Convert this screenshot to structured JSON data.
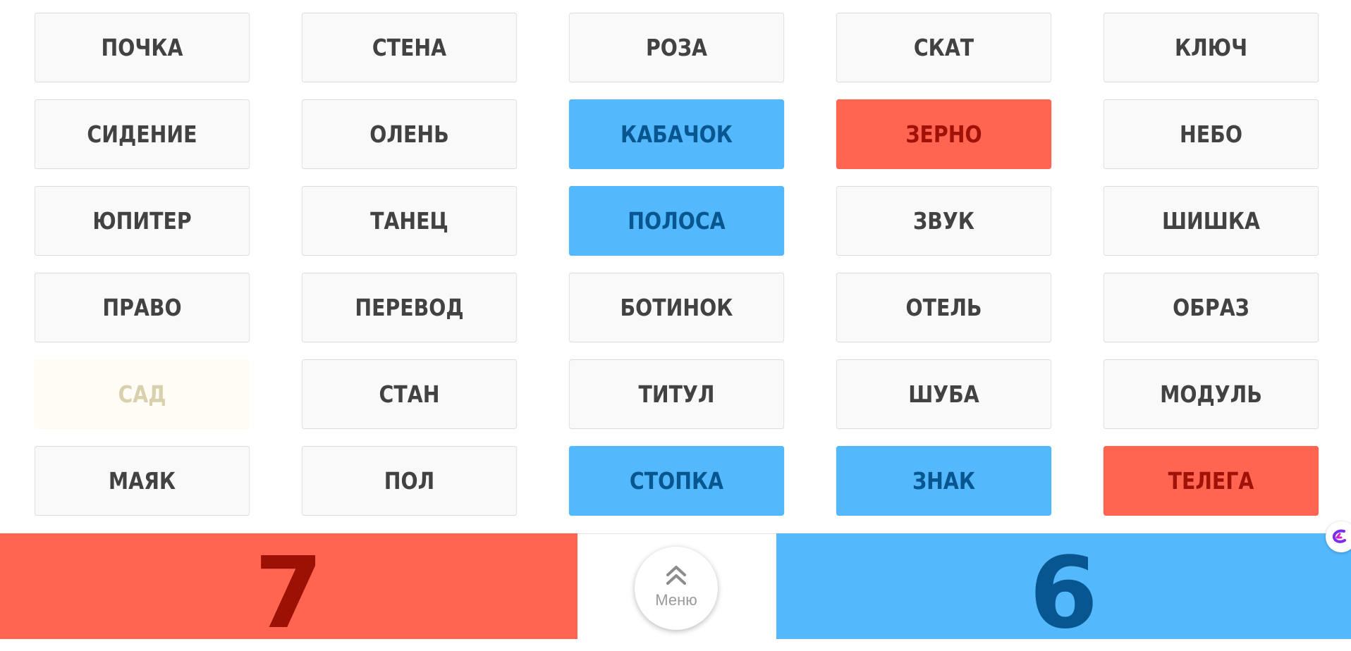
{
  "board": {
    "cards": [
      {
        "word": "ПОЧКА",
        "state": "unrevealed"
      },
      {
        "word": "СТЕНА",
        "state": "unrevealed"
      },
      {
        "word": "РОЗА",
        "state": "unrevealed"
      },
      {
        "word": "СКАТ",
        "state": "unrevealed"
      },
      {
        "word": "КЛЮЧ",
        "state": "unrevealed"
      },
      {
        "word": "СИДЕНИЕ",
        "state": "unrevealed"
      },
      {
        "word": "ОЛЕНЬ",
        "state": "unrevealed"
      },
      {
        "word": "КАБАЧОК",
        "state": "blue"
      },
      {
        "word": "ЗЕРНО",
        "state": "red"
      },
      {
        "word": "НЕБО",
        "state": "unrevealed"
      },
      {
        "word": "ЮПИТЕР",
        "state": "unrevealed"
      },
      {
        "word": "ТАНЕЦ",
        "state": "unrevealed"
      },
      {
        "word": "ПОЛОСА",
        "state": "blue"
      },
      {
        "word": "ЗВУК",
        "state": "unrevealed"
      },
      {
        "word": "ШИШКА",
        "state": "unrevealed"
      },
      {
        "word": "ПРАВО",
        "state": "unrevealed"
      },
      {
        "word": "ПЕРЕВОД",
        "state": "unrevealed"
      },
      {
        "word": "БОТИНОК",
        "state": "unrevealed"
      },
      {
        "word": "ОТЕЛЬ",
        "state": "unrevealed"
      },
      {
        "word": "ОБРАЗ",
        "state": "unrevealed"
      },
      {
        "word": "САД",
        "state": "neutral"
      },
      {
        "word": "СТАН",
        "state": "unrevealed"
      },
      {
        "word": "ТИТУЛ",
        "state": "unrevealed"
      },
      {
        "word": "ШУБА",
        "state": "unrevealed"
      },
      {
        "word": "МОДУЛЬ",
        "state": "unrevealed"
      },
      {
        "word": "МАЯК",
        "state": "unrevealed"
      },
      {
        "word": "ПОЛ",
        "state": "unrevealed"
      },
      {
        "word": "СТОПКА",
        "state": "blue"
      },
      {
        "word": "ЗНАК",
        "state": "blue"
      },
      {
        "word": "ТЕЛЕГА",
        "state": "red"
      }
    ]
  },
  "score": {
    "red": "7",
    "blue": "6"
  },
  "menu": {
    "label": "Меню",
    "icon": "double-chevron-up-icon"
  },
  "edge_widget": {
    "icon": "floating-assistant-icon"
  },
  "colors": {
    "red": "#ff6551",
    "red_text": "#a01208",
    "blue": "#53b9fc",
    "blue_text": "#08568f",
    "neutral": "#fffdf6",
    "neutral_text": "#d9d1ae",
    "card_bg": "#f9f9f9",
    "card_text": "#424242"
  }
}
